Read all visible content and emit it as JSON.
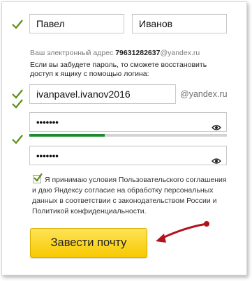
{
  "name": {
    "first_name_value": "Павел",
    "last_name_value": "Иванов"
  },
  "email_info": {
    "prefix": "Ваш электронный адрес ",
    "phone": "79631282637",
    "domain": "@yandex.ru"
  },
  "login_hint": {
    "line1": "Если вы забудете пароль, то сможете восстановить",
    "line2": "доступ к ящику с помощью логина:"
  },
  "login": {
    "value": "ivanpavel.ivanov2016",
    "domain": "@yandex.ru"
  },
  "password": {
    "value": "•••••••",
    "strength_fraction": 0.38
  },
  "password_confirm": {
    "value": "•••••••"
  },
  "agreement": {
    "checked": true,
    "line1": "Я принимаю условия Пользовательского соглашения",
    "line2": "и даю Яндексу согласие на обработку персональных",
    "line3": "данных в соответствии с законодательством России и",
    "line4": "Политикой конфиденциальности."
  },
  "submit": {
    "label": "Завести почту"
  },
  "colors": {
    "check": "#5c8f12",
    "strength": "#1d8a2f",
    "button": "#f9d523",
    "arrow": "#b3121d"
  },
  "icons": [
    "check-icon",
    "eye-icon",
    "arrow-icon"
  ]
}
